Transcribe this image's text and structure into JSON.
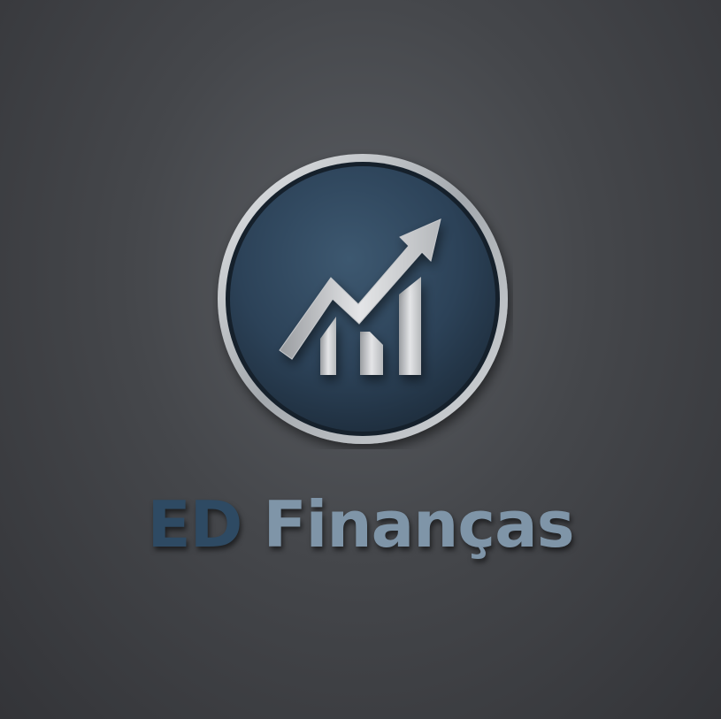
{
  "logo": {
    "icon": "growth-chart-arrow-icon",
    "colors": {
      "background": "#45474b",
      "disc": "#2c4258",
      "ring": "#c9cdd1",
      "chart": "#d8d9db"
    }
  },
  "brand": {
    "name_part_a": "ED",
    "name_part_b": "Finanças",
    "colors": {
      "part_a": "#2e4a63",
      "part_b": "#7f95a8"
    }
  }
}
